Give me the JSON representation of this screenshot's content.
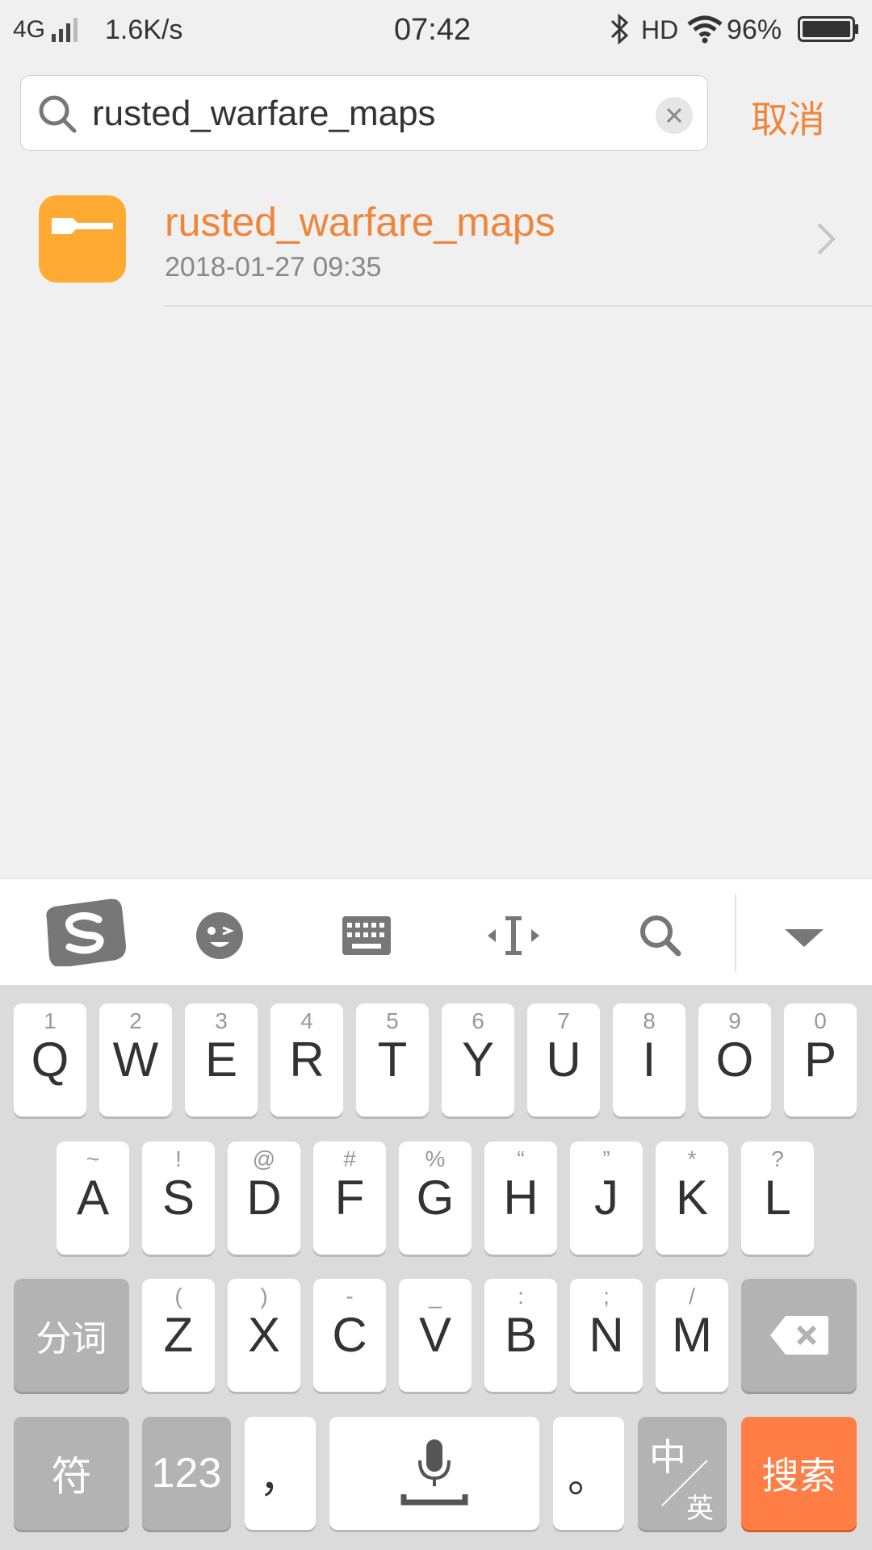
{
  "status_bar": {
    "network": "4G",
    "speed": "1.6K/s",
    "time": "07:42",
    "hd": "HD",
    "battery": "96%"
  },
  "search": {
    "query": "rusted_warfare_maps",
    "cancel_label": "取消"
  },
  "results": [
    {
      "name": "rusted_warfare_maps",
      "date": "2018-01-27 09:35",
      "icon": "folder-icon"
    }
  ],
  "keyboard": {
    "row1": [
      {
        "main": "Q",
        "sub": "1"
      },
      {
        "main": "W",
        "sub": "2"
      },
      {
        "main": "E",
        "sub": "3"
      },
      {
        "main": "R",
        "sub": "4"
      },
      {
        "main": "T",
        "sub": "5"
      },
      {
        "main": "Y",
        "sub": "6"
      },
      {
        "main": "U",
        "sub": "7"
      },
      {
        "main": "I",
        "sub": "8"
      },
      {
        "main": "O",
        "sub": "9"
      },
      {
        "main": "P",
        "sub": "0"
      }
    ],
    "row2": [
      {
        "main": "A",
        "sub": "~"
      },
      {
        "main": "S",
        "sub": "!"
      },
      {
        "main": "D",
        "sub": "@"
      },
      {
        "main": "F",
        "sub": "#"
      },
      {
        "main": "G",
        "sub": "%"
      },
      {
        "main": "H",
        "sub": "“"
      },
      {
        "main": "J",
        "sub": "”"
      },
      {
        "main": "K",
        "sub": "*"
      },
      {
        "main": "L",
        "sub": "?"
      }
    ],
    "row3": [
      {
        "main": "Z",
        "sub": "("
      },
      {
        "main": "X",
        "sub": ")"
      },
      {
        "main": "C",
        "sub": "-"
      },
      {
        "main": "V",
        "sub": "_"
      },
      {
        "main": "B",
        "sub": ":"
      },
      {
        "main": "N",
        "sub": ";"
      },
      {
        "main": "M",
        "sub": "/"
      }
    ],
    "fenci": "分词",
    "fu": "符",
    "num": "123",
    "comma": "，",
    "period": "。",
    "zh": "中",
    "en": "英",
    "search_key": "搜索"
  },
  "colors": {
    "accent": "#f0853a",
    "folder": "#ffaa33",
    "search_key": "#ff7e45"
  }
}
